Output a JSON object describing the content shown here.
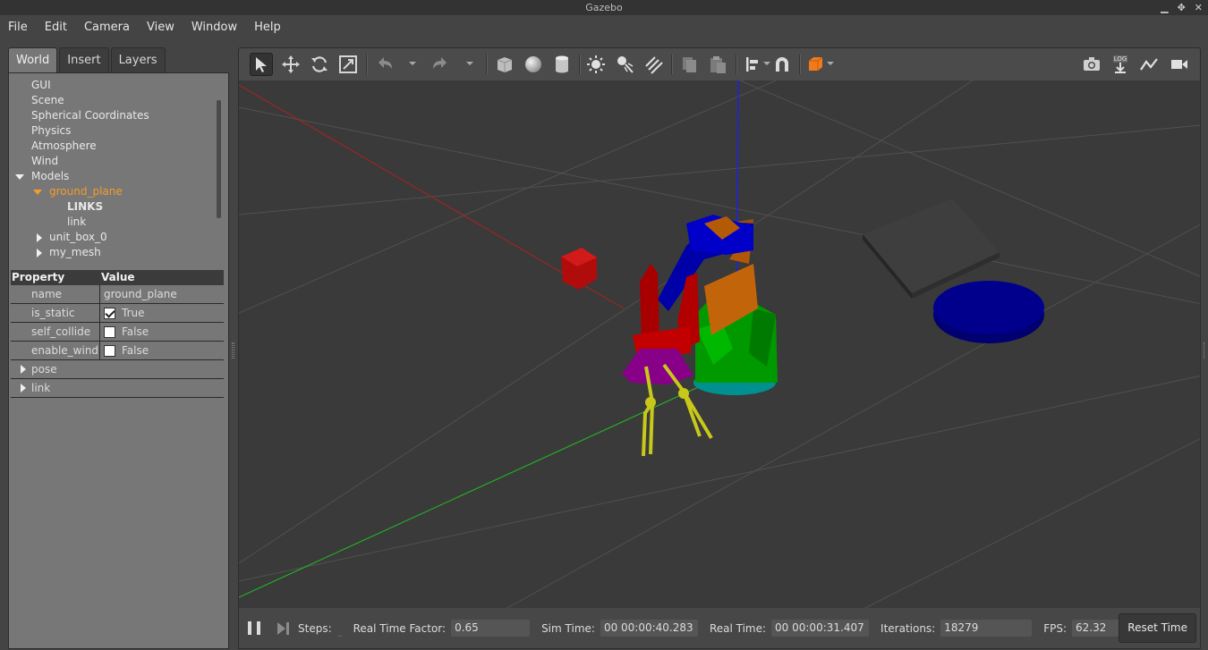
{
  "window": {
    "title": "Gazebo"
  },
  "menu": [
    "File",
    "Edit",
    "Camera",
    "View",
    "Window",
    "Help"
  ],
  "tabs": [
    "World",
    "Insert",
    "Layers"
  ],
  "tree": {
    "items": [
      "GUI",
      "Scene",
      "Spherical Coordinates",
      "Physics",
      "Atmosphere",
      "Wind"
    ],
    "models_label": "Models",
    "selected_model": "ground_plane",
    "links_header": "LINKS",
    "link": "link",
    "model2": "unit_box_0",
    "model3": "my_mesh"
  },
  "properties": {
    "header_property": "Property",
    "header_value": "Value",
    "name_key": "name",
    "name_value": "ground_plane",
    "is_static_key": "is_static",
    "is_static_value": "True",
    "is_static_checked": true,
    "self_collide_key": "self_collide",
    "self_collide_value": "False",
    "enable_wind_key": "enable_wind",
    "enable_wind_value": "False",
    "pose_label": "pose",
    "link_label": "link"
  },
  "toolbar": {
    "icons": [
      "select-arrow-icon",
      "translate-icon",
      "rotate-icon",
      "scale-icon",
      "undo-icon",
      "redo-icon",
      "box-icon",
      "sphere-icon",
      "cylinder-icon",
      "point-light-icon",
      "spot-light-icon",
      "directional-light-icon",
      "copy-icon",
      "paste-icon",
      "align-icon",
      "snap-magnet-icon",
      "view-angle-icon",
      "screenshot-icon",
      "log-icon",
      "plot-icon",
      "video-record-icon"
    ],
    "log_text": "LOG"
  },
  "statusbar": {
    "steps_label": "Steps:",
    "rtf_label": "Real Time Factor:",
    "rtf_value": "0.65",
    "sim_time_label": "Sim Time:",
    "sim_time_value": "00 00:00:40.283",
    "real_time_label": "Real Time:",
    "real_time_value": "00 00:00:31.407",
    "iterations_label": "Iterations:",
    "iterations_value": "18279",
    "fps_label": "FPS:",
    "fps_value": "62.32",
    "reset_label": "Reset Time"
  },
  "colors": {
    "accent_selected": "#f39c2a",
    "x_axis": "#d02020",
    "y_axis": "#20c020",
    "z_axis": "#2020e0"
  }
}
